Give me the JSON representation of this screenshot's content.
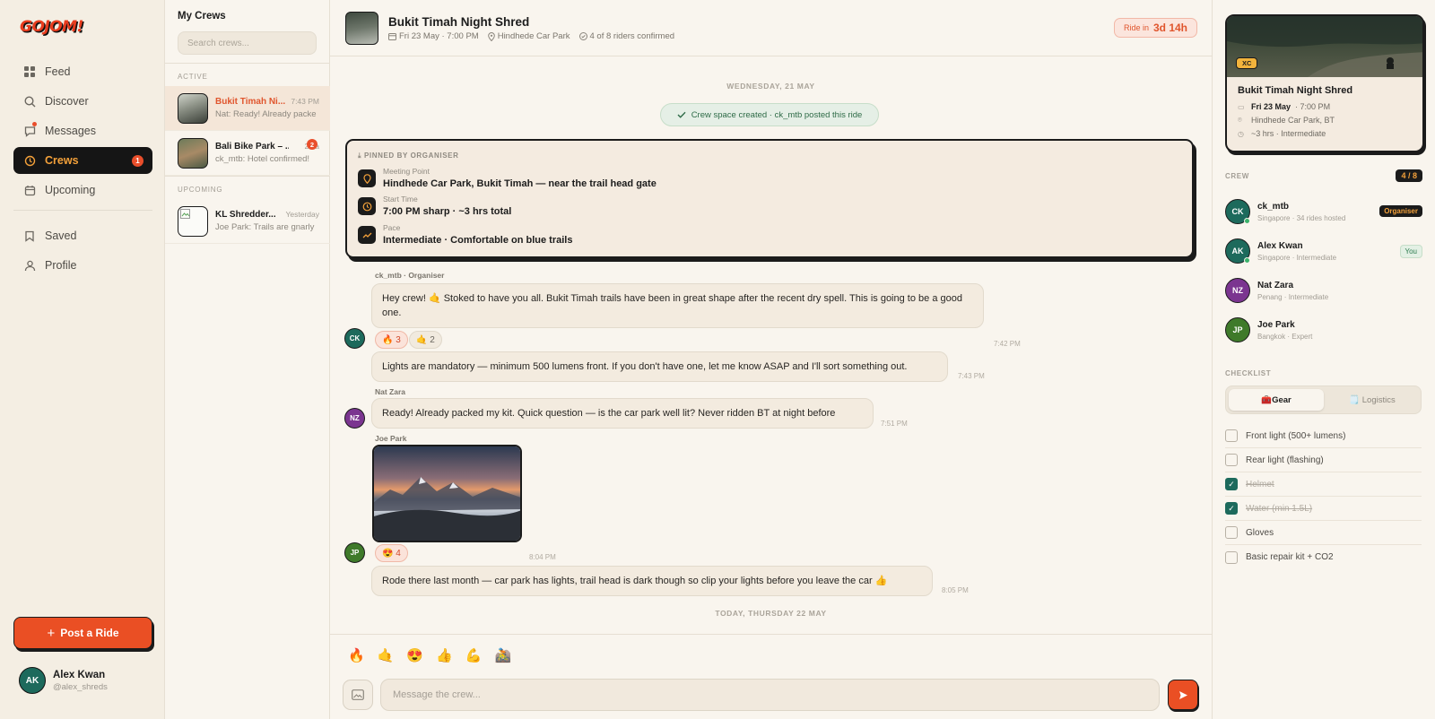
{
  "brand": {
    "logo": "GOJOM!"
  },
  "nav": {
    "items": [
      {
        "label": "Feed",
        "icon": "grid-icon"
      },
      {
        "label": "Discover",
        "icon": "search-icon"
      },
      {
        "label": "Messages",
        "icon": "message-icon"
      },
      {
        "label": "Crews",
        "icon": "crew-icon",
        "badge": "1"
      },
      {
        "label": "Upcoming",
        "icon": "calendar-icon"
      },
      {
        "label": "Saved",
        "icon": "bookmark-icon"
      },
      {
        "label": "Profile",
        "icon": "user-icon"
      }
    ],
    "post_label": "Post a Ride"
  },
  "user": {
    "initials": "AK",
    "name": "Alex Kwan",
    "handle": "@alex_shreds"
  },
  "crews": {
    "title": "My Crews",
    "search_placeholder": "Search crews...",
    "active_label": "ACTIVE",
    "upcoming_label": "UPCOMING",
    "active": [
      {
        "title": "Bukit Timah Ni...",
        "time": "7:43 PM",
        "preview": "Nat: Ready! Already packe"
      },
      {
        "title": "Bali Bike Park – ...",
        "time": "2h a",
        "preview": "ck_mtb: Hotel confirmed!",
        "badge": "2"
      }
    ],
    "upcoming": [
      {
        "title": "KL Shredder...",
        "time": "Yesterday",
        "preview": "Joe Park: Trails are gnarly"
      }
    ]
  },
  "chat": {
    "title": "Bukit Timah Night Shred",
    "date": "Fri 23 May · 7:00 PM",
    "location": "Hindhede Car Park",
    "riders": "4 of 8 riders confirmed",
    "ride_in_label": "Ride in",
    "ride_in_value": "3d 14h",
    "day1": "WEDNESDAY, 21 MAY",
    "system": "Crew space created · ck_mtb posted this ride",
    "day2": "TODAY, THURSDAY 22 MAY",
    "pinned": {
      "label": "PINNED BY ORGANISER",
      "items": [
        {
          "key": "Meeting Point",
          "value": "Hindhede Car Park, Bukit Timah — near the trail head gate"
        },
        {
          "key": "Start Time",
          "value": "7:00 PM sharp · ~3 hrs total"
        },
        {
          "key": "Pace",
          "value": "Intermediate · Comfortable on blue trails"
        }
      ]
    },
    "messages": [
      {
        "sender": "ck_mtb · Organiser",
        "text": "Hey crew! 🤙 Stoked to have you all. Bukit Timah trails have been in great shape after the recent dry spell. This is going to be a good one.",
        "time": "7:42 PM",
        "avatar": "CK",
        "reactions": [
          "🔥 3",
          "🤙 2"
        ]
      },
      {
        "text": "Lights are mandatory — minimum 500 lumens front. If you don't have one, let me know ASAP and I'll sort something out.",
        "time": "7:43 PM"
      },
      {
        "sender": "Nat Zara",
        "text": "Ready! Already packed my kit. Quick question — is the car park well lit? Never ridden BT at night before",
        "time": "7:51 PM",
        "avatar": "NZ"
      },
      {
        "sender": "Joe Park",
        "time": "8:04 PM",
        "avatar": "JP",
        "reactions": [
          "😍 4"
        ]
      },
      {
        "text": "Rode there last month — car park has lights, trail head is dark though so clip your lights before you leave the car 👍",
        "time": "8:05 PM"
      }
    ],
    "quick_emojis": [
      "🔥",
      "🤙",
      "😍",
      "👍",
      "💪",
      "🚵"
    ],
    "input_placeholder": "Message the crew..."
  },
  "ride": {
    "tag": "XC",
    "title": "Bukit Timah Night Shred",
    "date": "Fri 23 May",
    "time": "· 7:00 PM",
    "location": "Hindhede Car Park, BT",
    "duration": "~3 hrs · Intermediate"
  },
  "crew": {
    "label": "CREW",
    "count": "4 / 8",
    "members": [
      {
        "initials": "CK",
        "name": "ck_mtb",
        "info": "Singapore · 34 rides hosted",
        "tag": "Organiser",
        "color": "#1d6a5c",
        "online": true
      },
      {
        "initials": "AK",
        "name": "Alex Kwan",
        "info": "Singapore · Intermediate",
        "tag": "You",
        "color": "#1d6a5c",
        "online": true
      },
      {
        "initials": "NZ",
        "name": "Nat Zara",
        "info": "Penang · Intermediate",
        "color": "#7b3590"
      },
      {
        "initials": "JP",
        "name": "Joe Park",
        "info": "Bangkok · Expert",
        "color": "#3f7a2a"
      }
    ]
  },
  "checklist": {
    "label": "CHECKLIST",
    "tabs": [
      "🧰Gear",
      "🗒️ Logistics"
    ],
    "items": [
      {
        "text": "Front light (500+ lumens)",
        "done": false
      },
      {
        "text": "Rear light (flashing)",
        "done": false
      },
      {
        "text": "Helmet",
        "done": true
      },
      {
        "text": "Water (min 1.5L)",
        "done": true
      },
      {
        "text": "Gloves",
        "done": false
      },
      {
        "text": "Basic repair kit + CO2",
        "done": false
      }
    ]
  }
}
